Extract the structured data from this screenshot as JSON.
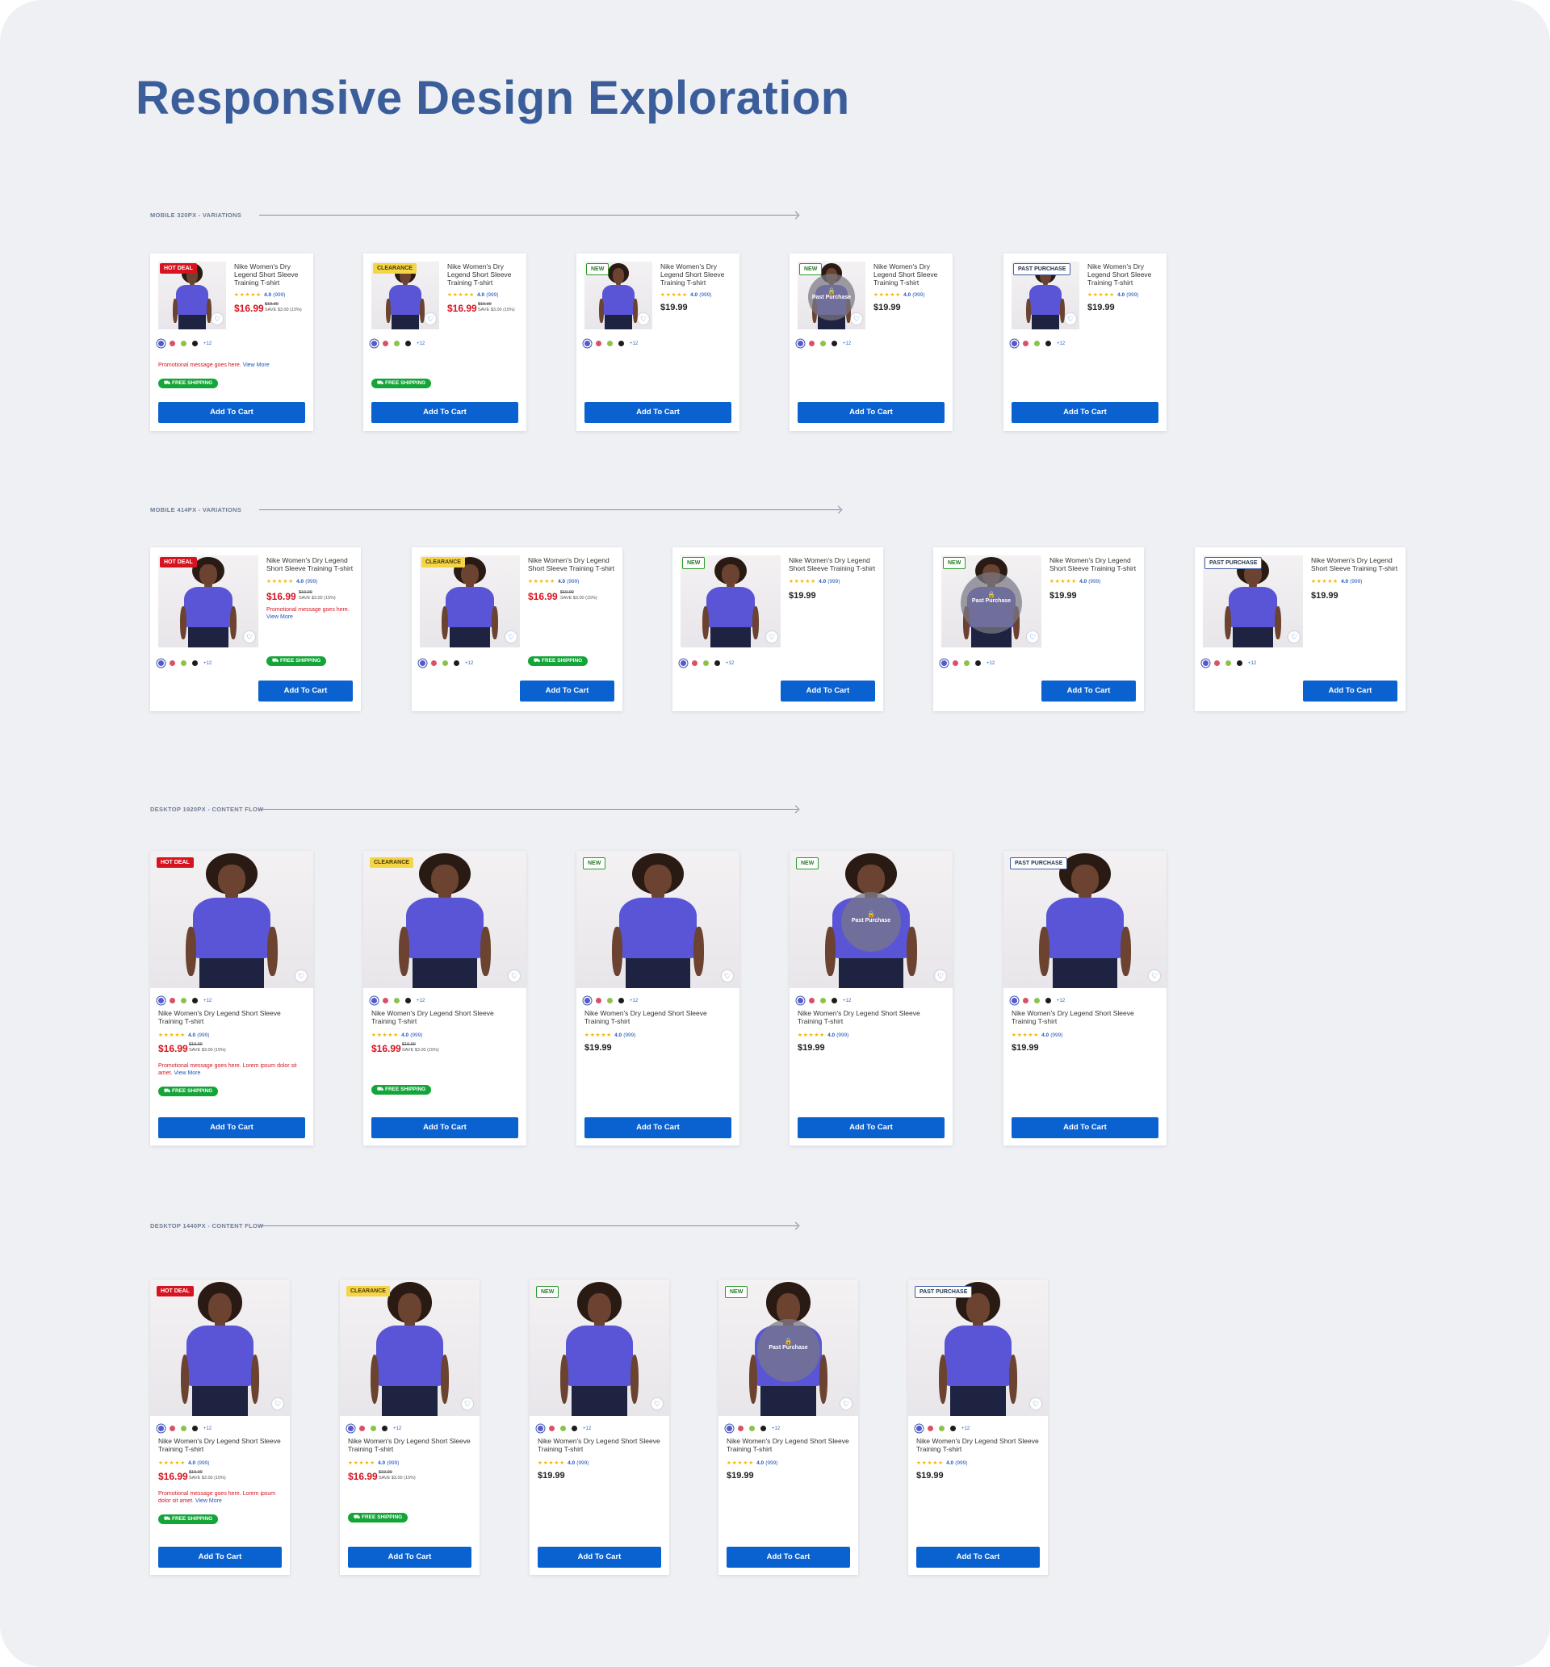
{
  "page": {
    "title": "Responsive Design Exploration"
  },
  "sections": [
    {
      "label": "MOBILE 320PX - VARIATIONS"
    },
    {
      "label": "MOBILE 414PX - VARIATIONS"
    },
    {
      "label": "DESKTOP 1920PX - CONTENT FLOW"
    },
    {
      "label": "DESKTOP 1440PX - CONTENT FLOW"
    }
  ],
  "product": {
    "name": "Nike Women's Dry Legend Short Sleeve Training T-shirt",
    "stars": "★★★★★",
    "rating": "4.0",
    "reviews": "(999)",
    "sale_price": "$16.99",
    "was_price": "$19.99",
    "save_text": "SAVE $3.00 (15%)",
    "regular_price": "$19.99",
    "swatch_more": "+12",
    "swatch_colors": [
      "#5a55d6",
      "#d9506a",
      "#8bc34a",
      "#1c1c1c"
    ],
    "add_to_cart": "Add To Cart",
    "free_shipping": "FREE SHIPPING",
    "past_purchase_overlay": "Past Purchase",
    "promo_short": "Promotional message goes here.",
    "promo_long": "Promotional message goes here. Lorem ipsum dolor sit amet.",
    "view_more": "View More"
  },
  "badges": {
    "hot": "HOT DEAL",
    "clearance": "CLEARANCE",
    "new": "NEW",
    "past": "PAST PURCHASE"
  },
  "colors": {
    "title": "#3b5e9b",
    "cart_button": "#0a62d0",
    "sale": "#d6141f",
    "shipping": "#13a538",
    "link": "#1f55b8"
  }
}
